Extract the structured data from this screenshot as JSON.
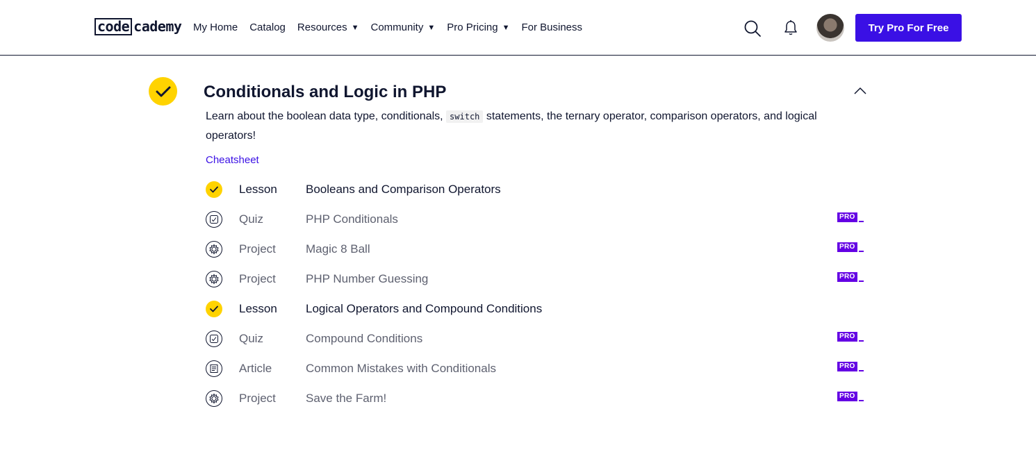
{
  "header": {
    "logo_code": "code",
    "logo_rest": "cademy",
    "nav": [
      {
        "label": "My Home",
        "caret": ""
      },
      {
        "label": "Catalog",
        "caret": ""
      },
      {
        "label": "Resources",
        "caret": "▼"
      },
      {
        "label": "Community",
        "caret": "▼"
      },
      {
        "label": "Pro Pricing",
        "caret": "▼"
      },
      {
        "label": "For Business",
        "caret": ""
      }
    ],
    "cta_label": "Try Pro For Free"
  },
  "module": {
    "title": "Conditionals and Logic in PHP",
    "description_before": "Learn about the boolean data type, conditionals, ",
    "description_code": "switch",
    "description_after": " statements, the ternary operator, comparison operators, and logical operators!",
    "cheatsheet_label": "Cheatsheet",
    "items": [
      {
        "type": "Lesson",
        "title": "Booleans and Comparison Operators",
        "icon": "check-icon",
        "pro": ""
      },
      {
        "type": "Quiz",
        "title": "PHP Conditionals",
        "icon": "quiz-icon",
        "pro": "PRO"
      },
      {
        "type": "Project",
        "title": "Magic 8 Ball",
        "icon": "project-icon",
        "pro": "PRO"
      },
      {
        "type": "Project",
        "title": "PHP Number Guessing",
        "icon": "project-icon",
        "pro": "PRO"
      },
      {
        "type": "Lesson",
        "title": "Logical Operators and Compound Conditions",
        "icon": "check-icon",
        "pro": ""
      },
      {
        "type": "Quiz",
        "title": "Compound Conditions",
        "icon": "quiz-icon",
        "pro": "PRO"
      },
      {
        "type": "Article",
        "title": "Common Mistakes with Conditionals",
        "icon": "article-icon",
        "pro": "PRO"
      },
      {
        "type": "Project",
        "title": "Save the Farm!",
        "icon": "project-icon",
        "pro": "PRO"
      }
    ]
  },
  "colors": {
    "brand": "#3a10e5",
    "complete": "#ffd300",
    "pro": "#6400e4",
    "text": "#10162f"
  }
}
